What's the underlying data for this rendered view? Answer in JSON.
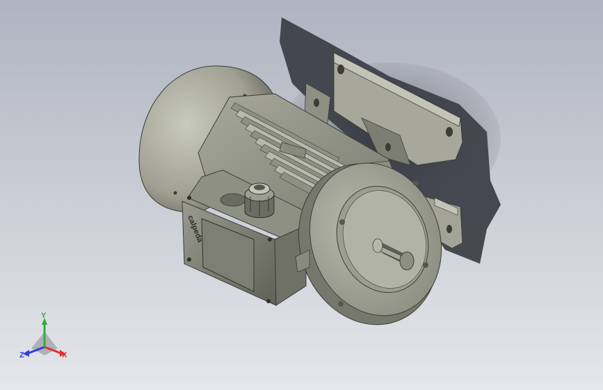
{
  "viewport": {
    "background_top": "#aeb4c0",
    "background_bottom": "#e4e6ea",
    "model_color": "#a3a497",
    "model_dark": "#5c5d54",
    "model_light": "#c9cabe",
    "shadow_color": "#3e4148"
  },
  "model": {
    "brand_text": "calpeda",
    "parts": [
      "motor-housing",
      "end-cap",
      "cooling-fins",
      "terminal-box",
      "cable-gland",
      "flange",
      "shaft",
      "mounting-feet"
    ]
  },
  "triad": {
    "x_label": "X",
    "y_label": "Y",
    "z_label": "Z",
    "x_color": "#e03030",
    "y_color": "#2fae3a",
    "z_color": "#2d3fd8"
  }
}
